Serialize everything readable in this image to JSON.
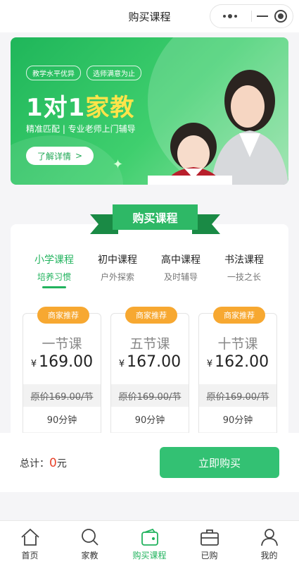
{
  "nav": {
    "title": "购买课程"
  },
  "banner": {
    "tags": [
      "教学水平优异",
      "选师满意为止"
    ],
    "headline_prefix": "1对1",
    "headline_highlight": "家教",
    "subline": "精准匹配 | 专业老师上门辅导",
    "detail_button": "了解详情",
    "detail_arrow": ">"
  },
  "section": {
    "title": "购买课程"
  },
  "tabs": [
    {
      "title": "小学课程",
      "sub": "培养习惯"
    },
    {
      "title": "初中课程",
      "sub": "户外探索"
    },
    {
      "title": "高中课程",
      "sub": "及时辅导"
    },
    {
      "title": "书法课程",
      "sub": "一技之长"
    }
  ],
  "packages": [
    {
      "badge": "商家推荐",
      "name": "一节课",
      "currency": "¥",
      "price": "169.00",
      "original": "原价169.00/节",
      "duration": "90分钟"
    },
    {
      "badge": "商家推荐",
      "name": "五节课",
      "currency": "¥",
      "price": "167.00",
      "original": "原价169.00/节",
      "duration": "90分钟"
    },
    {
      "badge": "商家推荐",
      "name": "十节课",
      "currency": "¥",
      "price": "162.00",
      "original": "原价169.00/节",
      "duration": "90分钟"
    }
  ],
  "buybar": {
    "total_label": "总计：",
    "total_amount": "0",
    "total_unit": "元",
    "buy_button": "立即购买"
  },
  "tabbar": [
    {
      "label": "首页",
      "icon": "home-icon"
    },
    {
      "label": "家教",
      "icon": "search-icon"
    },
    {
      "label": "购买课程",
      "icon": "wallet-icon"
    },
    {
      "label": "已购",
      "icon": "briefcase-icon"
    },
    {
      "label": "我的",
      "icon": "user-icon"
    }
  ],
  "colors": {
    "accent": "#22b35e",
    "badge": "#f7a831",
    "price_red": "#e8432b"
  }
}
